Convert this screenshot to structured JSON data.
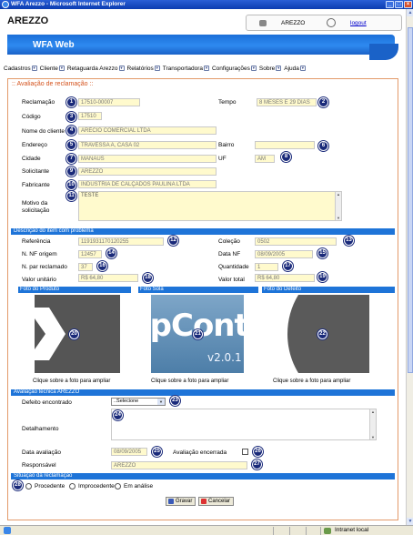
{
  "window": {
    "title": "WFA Arezzo - Microsoft Internet Explorer"
  },
  "header": {
    "app_name": "AREZZO",
    "user": "AREZZO",
    "logout": "logout",
    "brand": "WFA Web"
  },
  "menu": [
    "Cadastros",
    "Cliente",
    "Retaguarda Arezzo",
    "Relatórios",
    "Transportadora",
    "Configurações",
    "Sobre",
    "Ajuda"
  ],
  "form": {
    "title": ":: Avaliação de reclamação ::",
    "reclamacao": {
      "label": "Reclamação",
      "value": "17510-00007"
    },
    "tempo": {
      "label": "Tempo",
      "value": "8 MESES E 29 DIAS"
    },
    "codigo": {
      "label": "Código",
      "value": "17510"
    },
    "nome_cliente": {
      "label": "Nome do cliente",
      "value": "ARÉCIO COMERCIAL LTDA"
    },
    "endereco": {
      "label": "Endereço",
      "value": "TRAVESSA A, CASA 02"
    },
    "bairro": {
      "label": "Bairro",
      "value": ""
    },
    "cidade": {
      "label": "Cidade",
      "value": "MANAUS"
    },
    "uf": {
      "label": "UF",
      "value": "AM"
    },
    "solicitante": {
      "label": "Solicitante",
      "value": "AREZZO"
    },
    "fabricante": {
      "label": "Fabricante",
      "value": "INDÚSTRIA DE CALÇADOS PAULINA LTDA"
    },
    "motivo": {
      "label": "Motivo da solicitação",
      "value": "TESTE"
    }
  },
  "item": {
    "section_title": "Descrição do item com problema",
    "referencia": {
      "label": "Referência",
      "value": "1191931170120255"
    },
    "colecao": {
      "label": "Coleção",
      "value": "0502"
    },
    "nf_origem": {
      "label": "N. NF origem",
      "value": "12457"
    },
    "data_nf": {
      "label": "Data NF",
      "value": "08/09/2005"
    },
    "par_reclamado": {
      "label": "N. par reclamado",
      "value": "37"
    },
    "quantidade": {
      "label": "Quantidade",
      "value": "1"
    },
    "valor_unitario": {
      "label": "Valor unitário",
      "value": "R$ 64,80"
    },
    "valor_total": {
      "label": "Valor total",
      "value": "R$ 64,80"
    }
  },
  "photos": {
    "produto": {
      "title": "Foto do Produto",
      "caption": "Clique sobre a foto para ampliar"
    },
    "sola": {
      "title": "Foto Sola",
      "caption": "Clique sobre a foto para ampliar",
      "image_text": "ipControl",
      "image_version": "v2.0.1"
    },
    "defeito": {
      "title": "Foto do Defeito",
      "caption": "Clique sobre a foto para ampliar"
    }
  },
  "avaliacao": {
    "section_title": "Avaliação técnica AREZZO",
    "defeito": {
      "label": "Defeito encontrado",
      "value": "..Selecione"
    },
    "detalhamento": {
      "label": "Detalhamento",
      "value": ""
    },
    "data_avaliacao": {
      "label": "Data avaliação",
      "value": "08/09/2005"
    },
    "encerrada": {
      "label": "Avaliação encerrada"
    },
    "responsavel": {
      "label": "Responsável",
      "value": "AREZZO"
    }
  },
  "situacao": {
    "section_title": "Situação da reclamação",
    "options": [
      "Procedente",
      "Improcedente",
      "Em análise"
    ]
  },
  "buttons": {
    "save": "Gravar",
    "cancel": "Cancelar"
  },
  "status": {
    "zone": "Intranet local"
  },
  "badges": [
    "1",
    "2",
    "3",
    "4",
    "5",
    "6",
    "7",
    "8",
    "9",
    "10",
    "11",
    "12",
    "13",
    "14",
    "15",
    "16",
    "17",
    "18",
    "19",
    "20",
    "21",
    "22",
    "23",
    "24",
    "25",
    "26",
    "27",
    "28"
  ],
  "colors": {
    "badge": "#1a2a7a",
    "section": "#1e74d8",
    "field": "#fffacd",
    "accent": "#d4521c"
  }
}
